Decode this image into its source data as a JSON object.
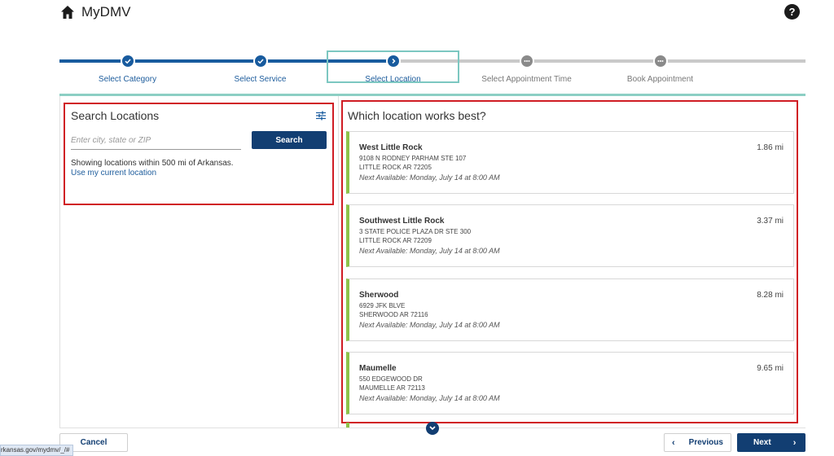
{
  "header": {
    "title": "MyDMV",
    "home_icon": "home-icon",
    "help_icon": "help-icon",
    "help_glyph": "?"
  },
  "stepper": {
    "steps": [
      {
        "label": "Select Category",
        "state": "done"
      },
      {
        "label": "Select Service",
        "state": "done"
      },
      {
        "label": "Select Location",
        "state": "current"
      },
      {
        "label": "Select Appointment Time",
        "state": "todo"
      },
      {
        "label": "Book Appointment",
        "state": "todo"
      }
    ]
  },
  "search": {
    "title": "Search Locations",
    "placeholder": "Enter city, state or ZIP",
    "value": "",
    "button_label": "Search",
    "showing_text": "Showing locations within 500 mi of Arkansas.",
    "use_location_link": "Use my current location"
  },
  "results": {
    "title": "Which location works best?",
    "locations": [
      {
        "name": "West Little Rock",
        "address1": "9108 N RODNEY PARHAM STE 107",
        "address2": "LITTLE ROCK AR 72205",
        "next_available": "Next Available: Monday, July 14 at 8:00 AM",
        "distance": "1.86 mi"
      },
      {
        "name": "Southwest Little Rock",
        "address1": "3 STATE POLICE PLAZA DR STE 300",
        "address2": "LITTLE ROCK AR 72209",
        "next_available": "Next Available: Monday, July 14 at 8:00 AM",
        "distance": "3.37 mi"
      },
      {
        "name": "Sherwood",
        "address1": "6929 JFK BLVE",
        "address2": "SHERWOOD AR 72116",
        "next_available": "Next Available: Monday, July 14 at 8:00 AM",
        "distance": "8.28 mi"
      },
      {
        "name": "Maumelle",
        "address1": "550 EDGEWOOD DR",
        "address2": "MAUMELLE AR 72113",
        "next_available": "Next Available: Monday, July 14 at 8:00 AM",
        "distance": "9.65 mi"
      }
    ]
  },
  "footer": {
    "cancel_label": "Cancel",
    "previous_label": "Previous",
    "next_label": "Next",
    "prev_chevron": "‹",
    "next_chevron": "›"
  },
  "status_bar": {
    "url": "rkansas.gov/mydmv/_/#"
  },
  "colors": {
    "primary": "#123e72",
    "step_done": "#185b9e",
    "accent_teal": "#8ccfc4",
    "card_accent": "#8ec24a",
    "highlight_red": "#d01c24"
  }
}
